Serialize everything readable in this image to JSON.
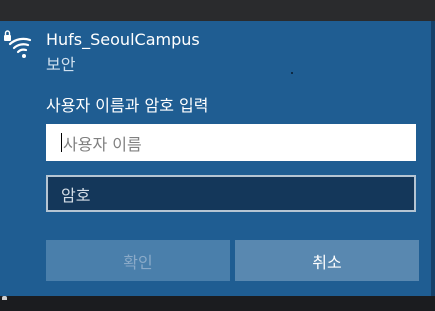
{
  "network": {
    "name": "Hufs_SeoulCampus",
    "security": "보안",
    "icon": "wifi-secured-icon"
  },
  "prompt": "사용자 이름과 암호 입력",
  "username_field": {
    "value": "",
    "placeholder": "사용자 이름"
  },
  "password_field": {
    "value": "",
    "placeholder": "암호"
  },
  "buttons": {
    "ok_label": "확인",
    "cancel_label": "취소"
  },
  "colors": {
    "panel": "#1f5d92",
    "field_dark": "#14375a",
    "button_cancel": "#5988b0",
    "button_ok_disabled": "#4a7fab"
  }
}
